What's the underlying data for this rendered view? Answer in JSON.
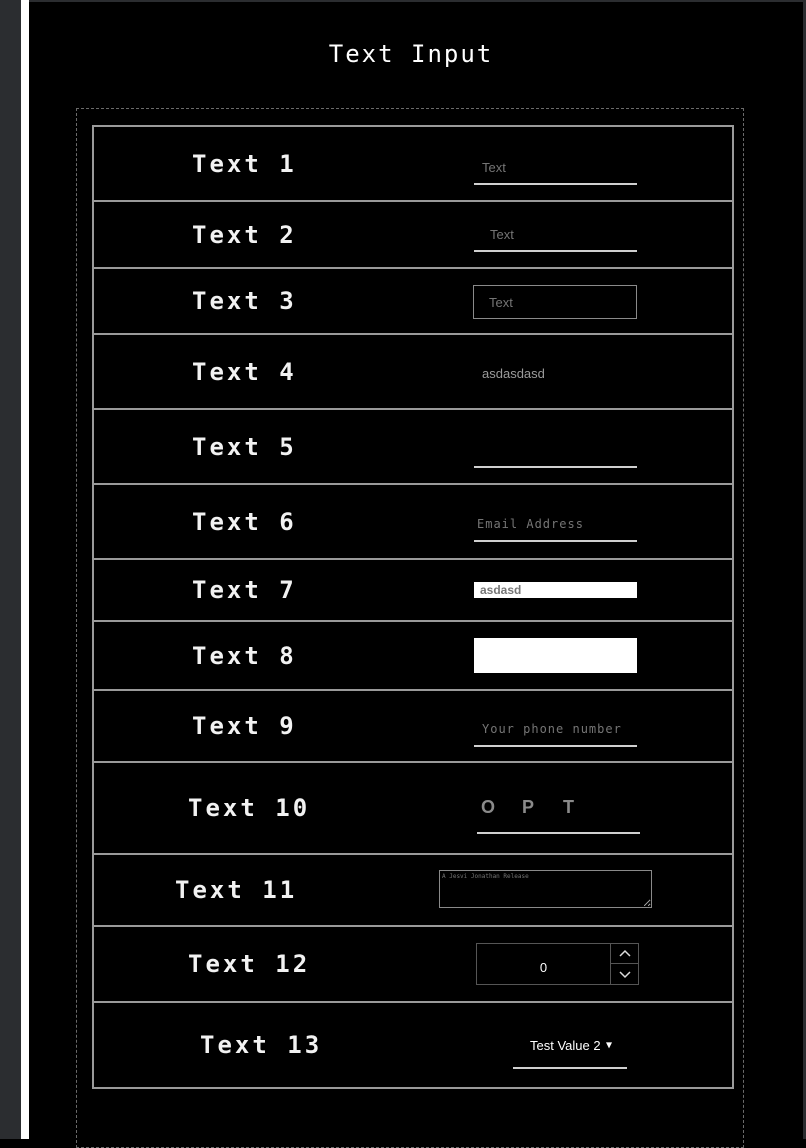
{
  "page_title": "Text Input",
  "rows": [
    {
      "label": "Text 1",
      "placeholder": "Text"
    },
    {
      "label": "Text 2",
      "placeholder": "Text"
    },
    {
      "label": "Text 3",
      "placeholder": "Text"
    },
    {
      "label": "Text 4",
      "value": "asdasdasd"
    },
    {
      "label": "Text 5",
      "value": ""
    },
    {
      "label": "Text 6",
      "placeholder": "Email Address"
    },
    {
      "label": "Text 7",
      "value": "asdasd"
    },
    {
      "label": "Text 8",
      "value": ""
    },
    {
      "label": "Text 9",
      "placeholder": "Your phone number"
    },
    {
      "label": "Text 10",
      "otp": [
        "O",
        "P",
        "T"
      ]
    },
    {
      "label": "Text 11",
      "placeholder": "A Jesvi Jonathan Release"
    },
    {
      "label": "Text 12",
      "value": "0"
    },
    {
      "label": "Text 13",
      "selected": "Test Value 2"
    }
  ]
}
